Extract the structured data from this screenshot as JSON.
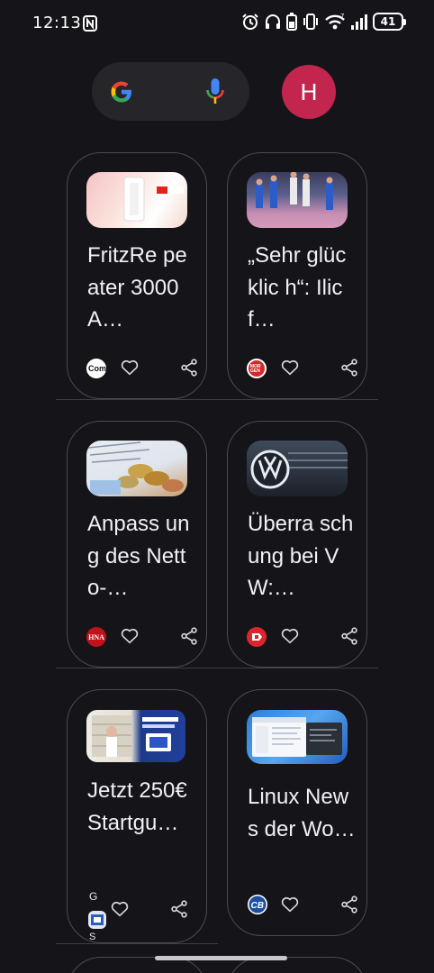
{
  "status_bar": {
    "time": "12:13",
    "battery": "41"
  },
  "header": {
    "avatar_letter": "H"
  },
  "cards": [
    {
      "title": "FritzRe peater 3000 A…",
      "source_icon": "com-source-icon"
    },
    {
      "title": "„Sehr glücklic h“: Ilic f…",
      "source_icon": "morgenpost-source-icon"
    },
    {
      "title": "Anpass ung des Netto-…",
      "source_icon": "hna-source-icon",
      "source_text": "HNA"
    },
    {
      "title": "Überra schung bei VW:…",
      "source_icon": "news-source-icon"
    },
    {
      "title": "Jetzt 250€ Startgu…",
      "source_icon": "gs-source-icon",
      "source_text_top": "G",
      "source_text_bottom": "S"
    },
    {
      "title": "Linux News der Wo…",
      "source_icon": "cb-source-icon",
      "source_text": "CB"
    }
  ],
  "colors": {
    "background": "#151519",
    "card_border": "#4a4a50",
    "avatar": "#c2264f"
  }
}
